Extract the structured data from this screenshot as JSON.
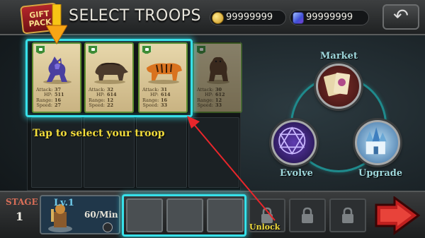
{
  "header": {
    "gift_line1": "GIFT",
    "gift_line2": "PACK",
    "title": "SELECT TROOPS",
    "coins": "99999999",
    "gems": "99999999"
  },
  "troops": [
    {
      "stats": [
        {
          "k": "Attack:",
          "v": "37"
        },
        {
          "k": "HP:",
          "v": "511"
        },
        {
          "k": "Range:",
          "v": "16"
        },
        {
          "k": "Speed:",
          "v": "27"
        }
      ],
      "icon": "purple-werewolf"
    },
    {
      "stats": [
        {
          "k": "Attack:",
          "v": "32"
        },
        {
          "k": "HP:",
          "v": "614"
        },
        {
          "k": "Range:",
          "v": "12"
        },
        {
          "k": "Speed:",
          "v": "22"
        }
      ],
      "icon": "brown-boar"
    },
    {
      "stats": [
        {
          "k": "Attack:",
          "v": "31"
        },
        {
          "k": "HP:",
          "v": "614"
        },
        {
          "k": "Range:",
          "v": "16"
        },
        {
          "k": "Speed:",
          "v": "33"
        }
      ],
      "icon": "tiger"
    },
    {
      "stats": [
        {
          "k": "Attack:",
          "v": "30"
        },
        {
          "k": "HP:",
          "v": "612"
        },
        {
          "k": "Range:",
          "v": "12"
        },
        {
          "k": "Speed:",
          "v": "33"
        }
      ],
      "icon": "brown-bear"
    }
  ],
  "hint": "Tap to select your troop",
  "menu": {
    "market": "Market",
    "evolve": "Evolve",
    "upgrade": "Upgrade"
  },
  "bottom": {
    "stage_label": "STAGE",
    "stage_number": "1",
    "level": "Lv.1",
    "rate": "60/Min",
    "unlock": "Unlock"
  },
  "colors": {
    "highlight": "#37e0e9",
    "hint_text": "#f2dd3c",
    "pointer_arrow": "#e8262b"
  }
}
